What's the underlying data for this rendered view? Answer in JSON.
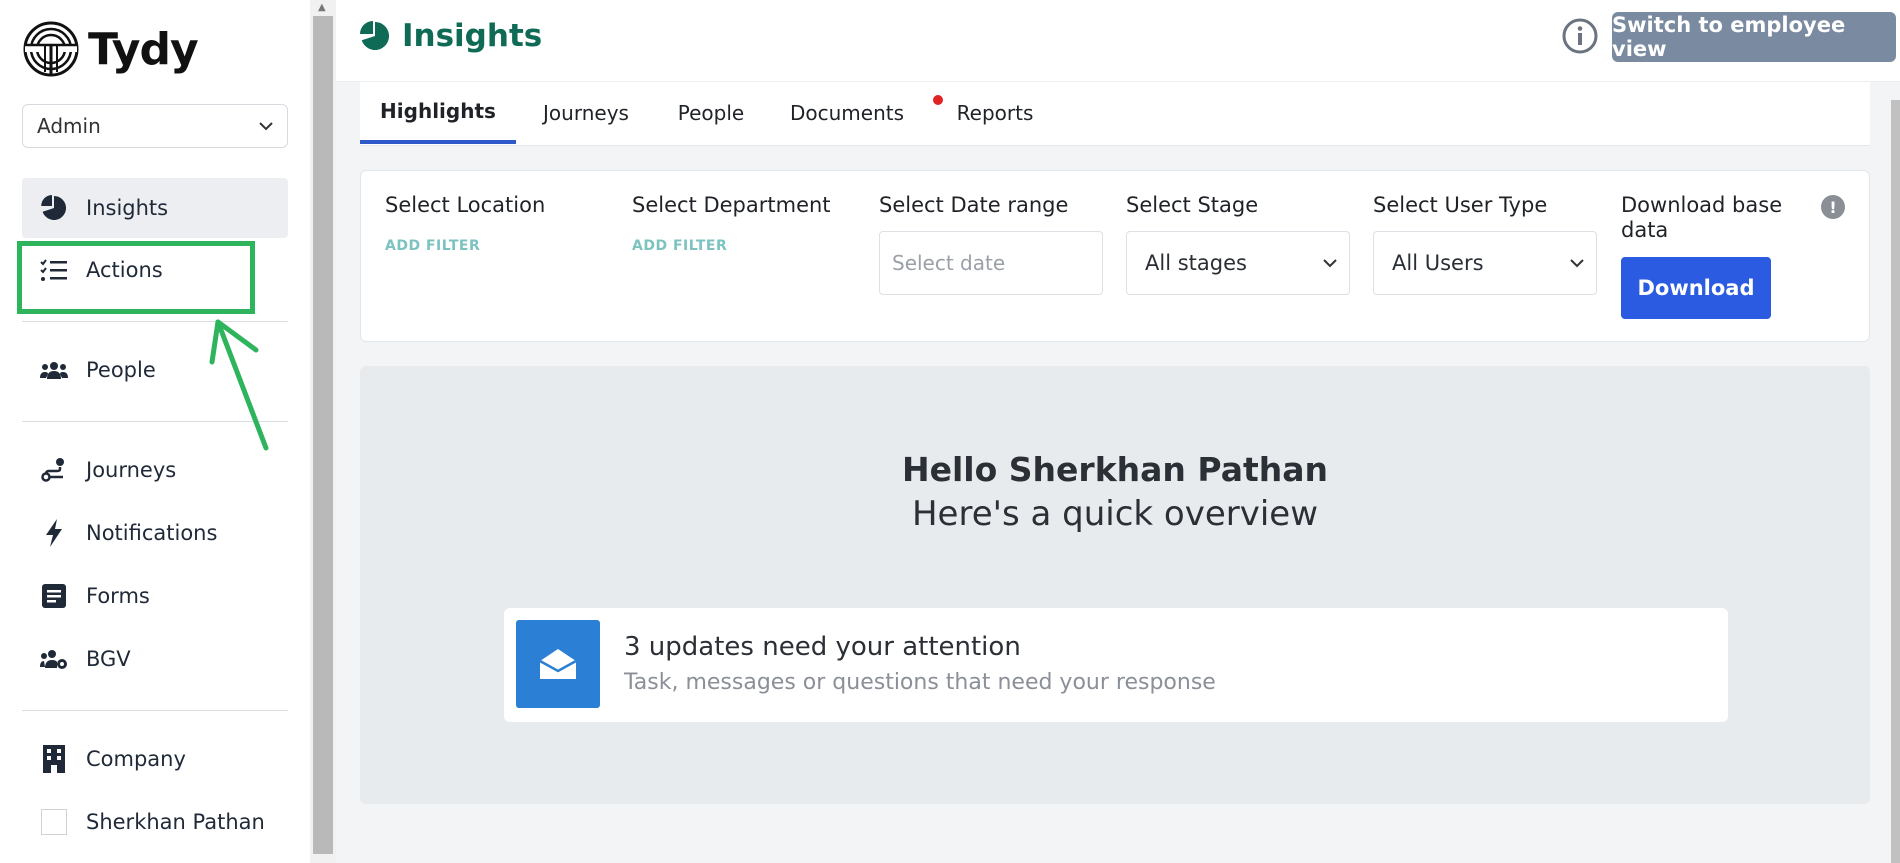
{
  "brand": {
    "name": "Tydy"
  },
  "role_select": {
    "value": "Admin"
  },
  "sidebar": {
    "items": [
      {
        "label": "Insights",
        "icon": "pie-chart-icon",
        "active": true
      },
      {
        "label": "Actions",
        "icon": "checklist-icon",
        "active": false
      },
      {
        "label": "People",
        "icon": "users-icon",
        "active": false
      },
      {
        "label": "Journeys",
        "icon": "route-icon",
        "active": false
      },
      {
        "label": "Notifications",
        "icon": "bolt-icon",
        "active": false
      },
      {
        "label": "Forms",
        "icon": "form-icon",
        "active": false
      },
      {
        "label": "BGV",
        "icon": "users-gear-icon",
        "active": false
      },
      {
        "label": "Company",
        "icon": "building-icon",
        "active": false
      },
      {
        "label": "Sherkhan Pathan",
        "icon": "avatar",
        "active": false
      }
    ]
  },
  "header": {
    "title": "Insights",
    "switch_label": "Switch to employee view"
  },
  "tabs": [
    {
      "label": "Highlights",
      "active": true
    },
    {
      "label": "Journeys",
      "active": false
    },
    {
      "label": "People",
      "active": false
    },
    {
      "label": "Documents",
      "active": false,
      "has_dot": true
    },
    {
      "label": "Reports",
      "active": false
    }
  ],
  "filters": {
    "location": {
      "label": "Select Location",
      "action": "ADD FILTER"
    },
    "department": {
      "label": "Select Department",
      "action": "ADD FILTER"
    },
    "date_range": {
      "label": "Select Date range",
      "placeholder": "Select date"
    },
    "stage": {
      "label": "Select Stage",
      "value": "All stages"
    },
    "user_type": {
      "label": "Select User Type",
      "value": "All Users"
    },
    "download": {
      "label": "Download base data",
      "button": "Download"
    }
  },
  "overview": {
    "greeting": "Hello Sherkhan Pathan",
    "subtitle": "Here's a quick overview",
    "updates_title": "3 updates need your attention",
    "updates_subtitle": "Task, messages or questions that need your response"
  },
  "colors": {
    "brand_green": "#0f6b56",
    "primary_blue": "#2b5be0",
    "annotation_green": "#2db45c",
    "muted_button": "#7a8aa0"
  }
}
